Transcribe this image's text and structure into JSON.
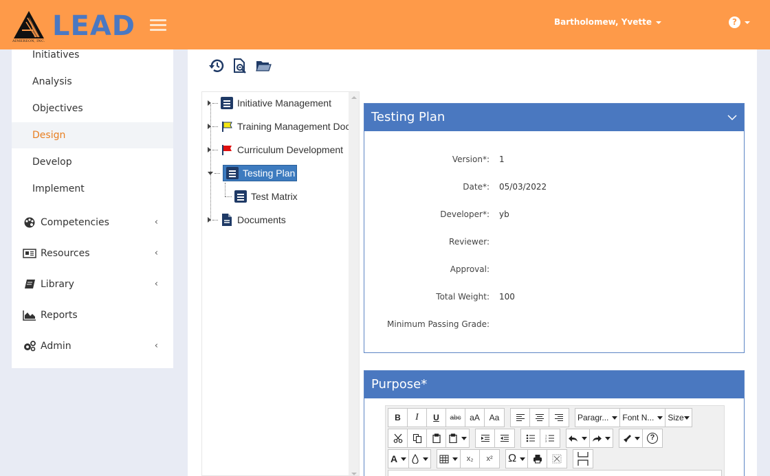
{
  "header": {
    "brand_name": "LEAD",
    "brand_company": "AIMEREON, INC.",
    "user_name": "Bartholomew, Yvette",
    "help_icon": "question-circle-icon",
    "colors": {
      "header_bg": "#fe9a49",
      "brand_blue": "#4a78c2"
    }
  },
  "sidebar": {
    "sub_items": [
      {
        "label": "Initiatives",
        "active": false
      },
      {
        "label": "Analysis",
        "active": false
      },
      {
        "label": "Objectives",
        "active": false
      },
      {
        "label": "Design",
        "active": true
      },
      {
        "label": "Develop",
        "active": false
      },
      {
        "label": "Implement",
        "active": false
      }
    ],
    "main_items": [
      {
        "label": "Competencies",
        "icon": "palette-icon",
        "has_submenu": true
      },
      {
        "label": "Resources",
        "icon": "newspaper-icon",
        "has_submenu": true
      },
      {
        "label": "Library",
        "icon": "book-icon",
        "has_submenu": true
      },
      {
        "label": "Reports",
        "icon": "area-chart-icon",
        "has_submenu": false
      },
      {
        "label": "Admin",
        "icon": "cogs-icon",
        "has_submenu": true
      }
    ],
    "active_color": "#e87e20"
  },
  "toolbar": {
    "icons": [
      "history-icon",
      "document-search-icon",
      "folder-open-icon"
    ]
  },
  "tree": {
    "nodes": [
      {
        "label": "Initiative Management",
        "icon": "document-list-icon",
        "expanded": false,
        "level": 0
      },
      {
        "label": "Training Management Doc",
        "icon": "yellow-flag-icon",
        "expanded": false,
        "level": 0
      },
      {
        "label": "Curriculum Development",
        "icon": "red-flag-icon",
        "expanded": false,
        "level": 0
      },
      {
        "label": "Testing Plan",
        "icon": "document-list-icon",
        "expanded": true,
        "level": 0,
        "selected": true
      },
      {
        "label": "Test Matrix",
        "icon": "document-list-icon",
        "level": 1
      },
      {
        "label": "Documents",
        "icon": "file-icon",
        "expanded": false,
        "level": 0
      }
    ]
  },
  "testing_plan": {
    "title": "Testing Plan",
    "fields": [
      {
        "label": "Version*:",
        "value": "1"
      },
      {
        "label": "Date*:",
        "value": "05/03/2022"
      },
      {
        "label": "Developer*:",
        "value": "yb"
      },
      {
        "label": "Reviewer:",
        "value": ""
      },
      {
        "label": "Approval:",
        "value": ""
      },
      {
        "label": "Total Weight:",
        "value": "100"
      },
      {
        "label": "Minimum Passing Grade:",
        "value": ""
      }
    ]
  },
  "purpose": {
    "title": "Purpose*",
    "editor": {
      "bold": "B",
      "italic": "I",
      "underline": "U",
      "strike": "abc",
      "lowercase": "aA",
      "capitalize": "Aa",
      "paragraph": "Paragr...",
      "font_name": "Font N...",
      "size": "Size",
      "font_color": "A",
      "omega": "Ω",
      "subscript": "x₂",
      "superscript": "x²",
      "help": "?"
    }
  }
}
